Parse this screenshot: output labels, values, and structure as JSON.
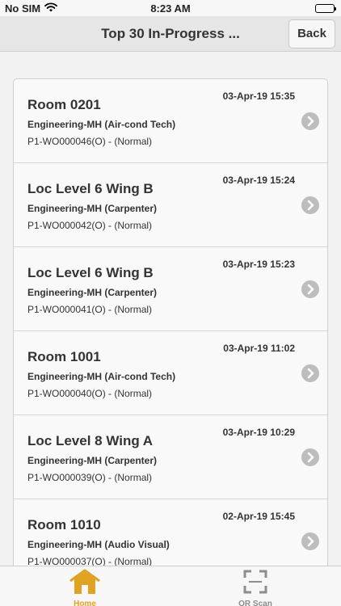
{
  "status_bar": {
    "carrier": "No SIM",
    "time": "8:23 AM",
    "wifi_icon": "wifi-icon",
    "battery_icon": "battery-icon"
  },
  "nav": {
    "title": "Top 30 In-Progress ...",
    "back_label": "Back"
  },
  "work_orders": [
    {
      "location": "Room 0201",
      "date": "03-Apr-19 15:35",
      "department": "Engineering-MH (Air-cond Tech)",
      "wo": "P1-WO000046(O) - (Normal)"
    },
    {
      "location": "Loc Level 6 Wing B",
      "date": "03-Apr-19 15:24",
      "department": "Engineering-MH (Carpenter)",
      "wo": "P1-WO000042(O) - (Normal)"
    },
    {
      "location": "Loc Level 6 Wing B",
      "date": "03-Apr-19 15:23",
      "department": "Engineering-MH (Carpenter)",
      "wo": "P1-WO000041(O) - (Normal)"
    },
    {
      "location": "Room 1001",
      "date": "03-Apr-19 11:02",
      "department": "Engineering-MH (Air-cond Tech)",
      "wo": "P1-WO000040(O) - (Normal)"
    },
    {
      "location": "Loc Level 8 Wing A",
      "date": "03-Apr-19 10:29",
      "department": "Engineering-MH (Carpenter)",
      "wo": "P1-WO000039(O) - (Normal)"
    },
    {
      "location": "Room 1010",
      "date": "02-Apr-19 15:45",
      "department": "Engineering-MH (Audio Visual)",
      "wo": "P1-WO000037(O) - (Normal)"
    }
  ],
  "tabs": [
    {
      "label": "Home",
      "icon": "home-icon",
      "active": true,
      "color": "#e0a221"
    },
    {
      "label": "QR Scan",
      "icon": "qr-scan-icon",
      "active": false,
      "color": "#8c8c8c"
    }
  ]
}
